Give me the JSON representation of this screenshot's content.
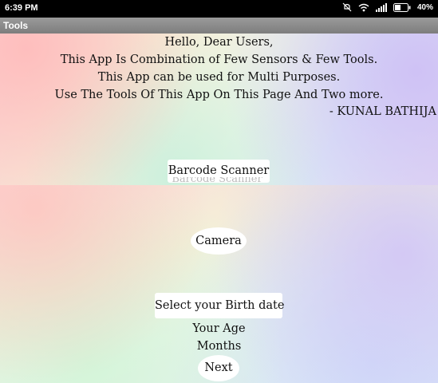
{
  "status_bar": {
    "time": "6:39 PM",
    "battery": "40%",
    "icons": [
      "alarm-off-icon",
      "wifi-icon",
      "signal-icon",
      "battery-icon"
    ]
  },
  "app_bar": {
    "title": "Tools"
  },
  "intro": {
    "line1": "Hello, Dear Users,",
    "line2": "This App Is Combination of Few Sensors & Few Tools.",
    "line3": "This App can be used for Multi Purposes.",
    "line4": "Use The Tools Of This App On This Page And Two more.",
    "signature": "- KUNAL BATHIJA"
  },
  "buttons": {
    "barcode": "Barcode Scanner",
    "camera": "Camera",
    "birth_date": "Select your Birth date",
    "next": "Next"
  },
  "results": {
    "age": "Your Age",
    "months": "Months"
  }
}
